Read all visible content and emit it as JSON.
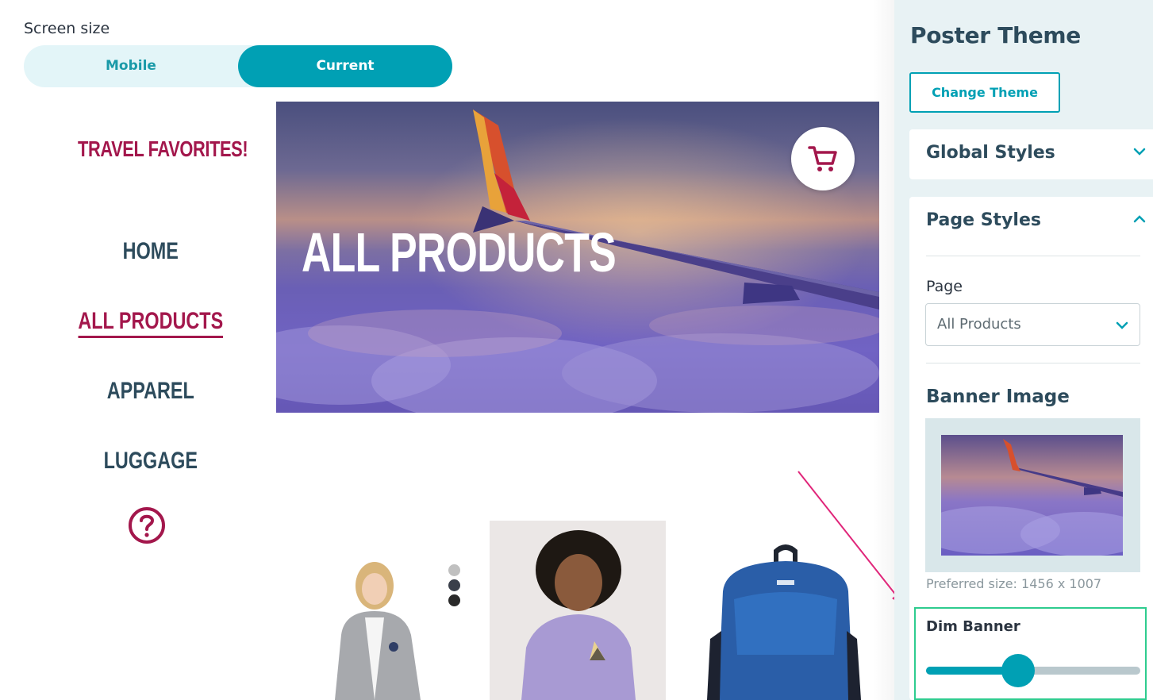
{
  "screen_size": {
    "label": "Screen size",
    "options": [
      "Mobile",
      "Current"
    ],
    "selected": "Current"
  },
  "store": {
    "title": "TRAVEL FAVORITES!",
    "nav": [
      "HOME",
      "ALL PRODUCTS",
      "APPAREL",
      "LUGGAGE"
    ],
    "active_nav": "ALL PRODUCTS",
    "icons": [
      "help-icon",
      "cart-icon"
    ]
  },
  "banner": {
    "title": "ALL PRODUCTS"
  },
  "products": {
    "color_swatches": [
      "#c0c0c0",
      "#3a3f4a",
      "#2a2a2a"
    ]
  },
  "sidebar": {
    "title": "Poster Theme",
    "change_theme_label": "Change Theme",
    "global_styles_label": "Global Styles",
    "page_styles_label": "Page Styles",
    "page_field_label": "Page",
    "page_value": "All Products",
    "banner_image_label": "Banner Image",
    "preferred_size": "Preferred size: 1456 x 1007",
    "dim_banner_label": "Dim Banner",
    "dim_banner_value": 0.43
  },
  "colors": {
    "accent": "#00a0b4",
    "brand": "#a3174c",
    "nav_text": "#2d4b5c",
    "highlight_box": "#2ecc8f",
    "annotation_arrow": "#e0267a"
  }
}
